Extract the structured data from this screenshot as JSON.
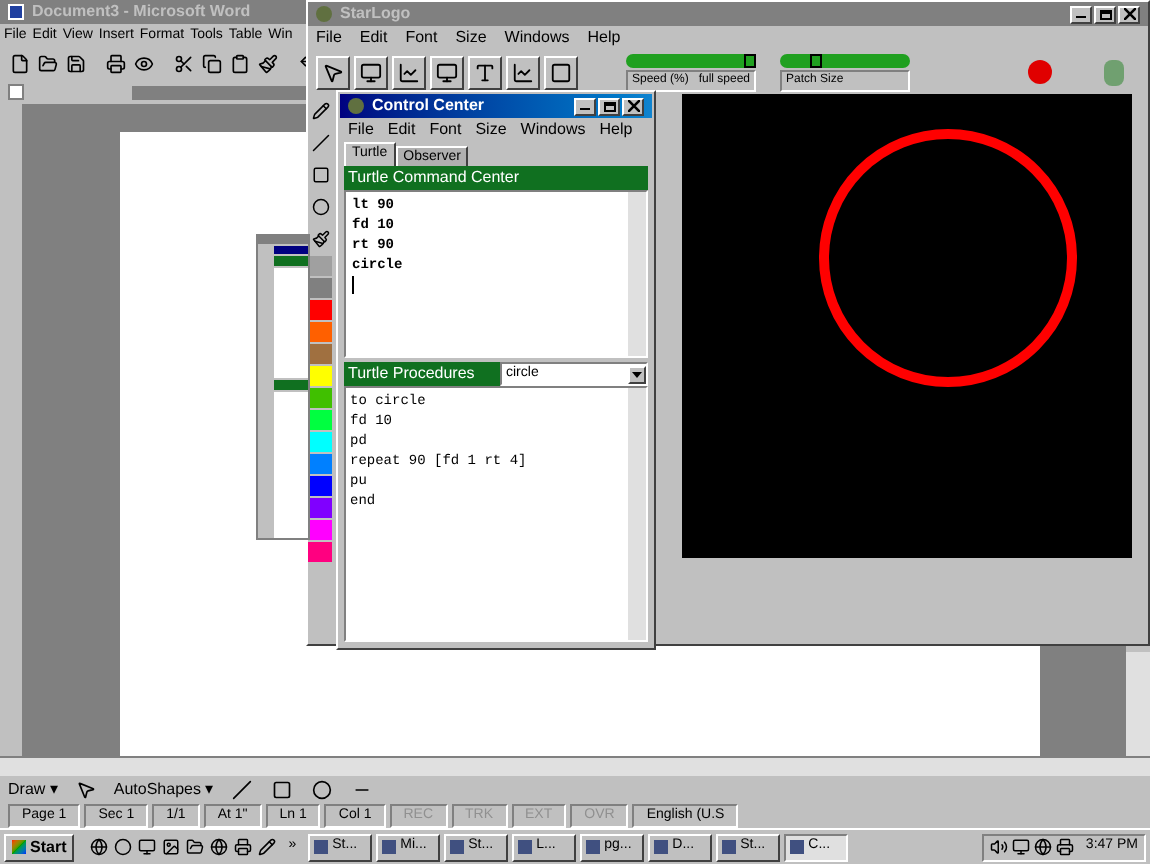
{
  "word": {
    "title": "Document3 - Microsoft Word",
    "menu": [
      "File",
      "Edit",
      "View",
      "Insert",
      "Format",
      "Tools",
      "Table",
      "Win"
    ],
    "drawing_toolbar": {
      "draw": "Draw ▾",
      "autoshapes": "AutoShapes ▾"
    },
    "status_bar": [
      {
        "text": "Page 1",
        "disabled": false
      },
      {
        "text": "Sec 1",
        "disabled": false
      },
      {
        "text": "1/1",
        "disabled": false
      },
      {
        "text": "At 1\"",
        "disabled": false
      },
      {
        "text": "Ln 1",
        "disabled": false
      },
      {
        "text": "Col 1",
        "disabled": false
      },
      {
        "text": "REC",
        "disabled": true
      },
      {
        "text": "TRK",
        "disabled": true
      },
      {
        "text": "EXT",
        "disabled": true
      },
      {
        "text": "OVR",
        "disabled": true
      },
      {
        "text": "English (U.S",
        "disabled": false
      }
    ]
  },
  "starlogo": {
    "title": "StarLogo",
    "menu": [
      "File",
      "Edit",
      "Font",
      "Size",
      "Windows",
      "Help"
    ],
    "sliders": [
      {
        "label": "Speed (%)",
        "reading": "full speed",
        "level": 1.0
      },
      {
        "label": "Patch Size",
        "level": 0.25
      }
    ],
    "palette": [
      {
        "color": "#a0a0a0"
      },
      {
        "color": "#808080"
      },
      {
        "color": "#ff0000"
      },
      {
        "color": "#ff6000"
      },
      {
        "color": "#a07040"
      },
      {
        "color": "#ffff00"
      },
      {
        "color": "#40c000"
      },
      {
        "color": "#00ff40"
      },
      {
        "color": "#00ffff"
      },
      {
        "color": "#0080ff"
      },
      {
        "color": "#0000ff"
      },
      {
        "color": "#8000ff"
      },
      {
        "color": "#ff00ff"
      },
      {
        "color": "#ff0080"
      }
    ]
  },
  "control_center": {
    "title": "Control Center",
    "menu": [
      "File",
      "Edit",
      "Font",
      "Size",
      "Windows",
      "Help"
    ],
    "tabs": [
      {
        "label": "Turtle",
        "selected": true
      },
      {
        "label": "Observer",
        "selected": false
      }
    ],
    "command_center": {
      "title": "Turtle Command Center",
      "lines": [
        "lt 90",
        "fd 10",
        "rt 90",
        "circle"
      ]
    },
    "procedures": {
      "title": "Turtle Procedures",
      "selected_procedure": "circle",
      "lines": [
        "to circle",
        "fd 10",
        "pd",
        "repeat 90 [fd 1 rt 4]",
        "pu",
        "end"
      ]
    }
  },
  "taskbar": {
    "start": "Start",
    "more": "»",
    "tasks": [
      {
        "label": "St...",
        "selected": false
      },
      {
        "label": "Mi...",
        "selected": false
      },
      {
        "label": "St...",
        "selected": false
      },
      {
        "label": "L...",
        "selected": false
      },
      {
        "label": "pg...",
        "selected": false
      },
      {
        "label": "D...",
        "selected": false
      },
      {
        "label": "St...",
        "selected": false
      },
      {
        "label": "C...",
        "selected": true
      }
    ],
    "clock": "3:47 PM"
  }
}
